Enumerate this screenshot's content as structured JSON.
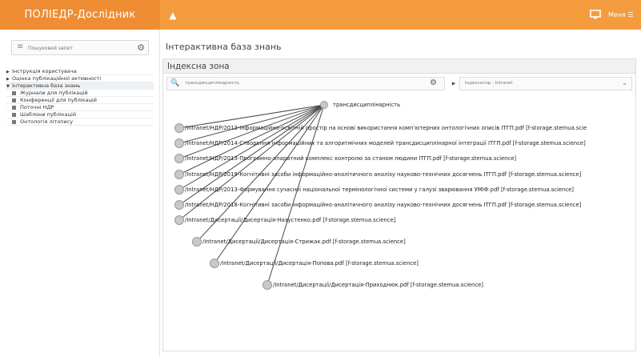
{
  "header": {
    "app_title": "ПОЛІЕДР-Дослідник",
    "menu_label": "Меня",
    "icons": {
      "home": "home-icon",
      "screen": "monitor-icon",
      "menu": "hamburger-icon"
    }
  },
  "sidebar": {
    "search_placeholder": "Пошуковий запит",
    "items": [
      {
        "label": "Інструкція користувача",
        "expanded": false
      },
      {
        "label": "Оцінка публікаційної активності",
        "expanded": false
      },
      {
        "label": "Інтерактивна база знань",
        "expanded": true,
        "children": [
          {
            "label": "Журнали для публікацій"
          },
          {
            "label": "Конференції для публікацій"
          },
          {
            "label": "Поточні НДР"
          },
          {
            "label": "Шаблони публікацій"
          },
          {
            "label": "Онтологія літопису"
          }
        ]
      }
    ]
  },
  "main": {
    "page_title": "Інтерактивна база знань",
    "panel_title": "Індексна зона",
    "query_value": "трансдисциплінарність",
    "selector_value": "Індексатор - Intranet",
    "graph": {
      "root": "трансдисциплінарність",
      "nodes": [
        "/Intranet/НДР/2013-Інформаційно-освітній простір на основі використання комп’ютерних онтологічних описів ІТГП.pdf [f-storage.stemua.scie",
        "/Intranet/НДР/2014-Створення інформаційних та алгоритмічних моделей трансдисциплінарної інтеграції ІТГП.pdf [f-storage.stemua.science]",
        "/Intranet/НДР/2013-Програмно-апаратний комплекс контролю за станом людини ІТГП.pdf [f-storage.stemua.science]",
        "/Intranet/НДР/2019-Когнітивні засоби інформаційно-аналітичного аналізу науково-технічних досягнень ІТГП.pdf [f-storage.stemua.science]",
        "/Intranet/НДР/2013-Формування сучасної національної термінологічної системи у галузі зварювання УМІФ.pdf [f-storage.stemua.science]",
        "/Intranet/НДР/2018-Когнітивні засоби інформаційно-аналітичного аналізу науково-технічних досягнень ІТГП.pdf [f-storage.stemua.science]",
        "/Intranet/Дисертації/Дисертація-Назустенко.pdf [f-storage.stemua.science]",
        "/Intranet/Дисертації/Дисертація-Стрижак.pdf [f-storage.stemua.science]",
        "/Intranet/Дисертації/Дисертація-Попова.pdf [f-storage.stemua.science]",
        "/Intranet/Дисертації/Дисертація-Приходнюк.pdf [f-storage.stemua.science]"
      ]
    }
  }
}
